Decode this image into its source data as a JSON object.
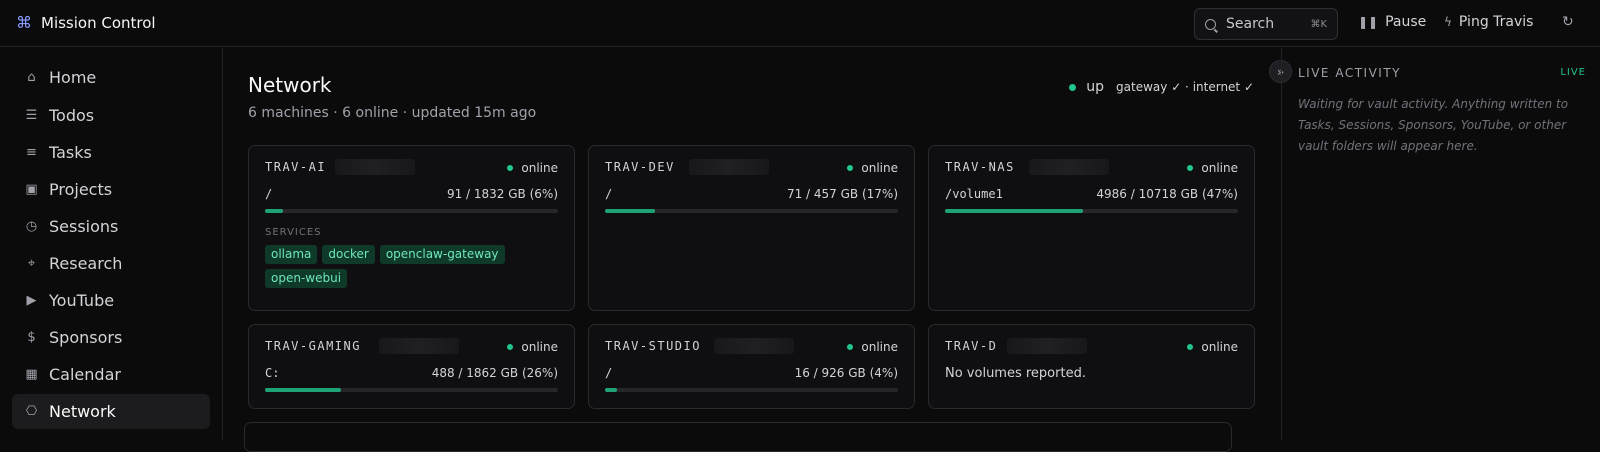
{
  "app": {
    "title": "Mission Control",
    "icon": "command-icon"
  },
  "topbar": {
    "search_label": "Search",
    "search_shortcut": "⌘K",
    "pause_label": "Pause",
    "ping_label": "Ping Travis"
  },
  "sidebar": {
    "items": [
      {
        "label": "Home",
        "icon": "home-icon"
      },
      {
        "label": "Todos",
        "icon": "list-checks-icon"
      },
      {
        "label": "Tasks",
        "icon": "list-todo-icon"
      },
      {
        "label": "Projects",
        "icon": "folders-icon"
      },
      {
        "label": "Sessions",
        "icon": "history-icon"
      },
      {
        "label": "Research",
        "icon": "telescope-icon"
      },
      {
        "label": "YouTube",
        "icon": "youtube-icon"
      },
      {
        "label": "Sponsors",
        "icon": "dollar-icon"
      },
      {
        "label": "Calendar",
        "icon": "calendar-icon"
      },
      {
        "label": "Network",
        "icon": "network-icon",
        "active": true
      }
    ]
  },
  "main": {
    "title": "Network",
    "subtitle": "6 machines · 6 online · updated 15m ago",
    "status": {
      "state": "up",
      "checks": "gateway ✓ · internet ✓",
      "color": "#22c58b"
    },
    "services_label": "SERVICES",
    "cards": [
      {
        "name": "TRAV-AI",
        "status": "online",
        "volume": "/",
        "usage": "91 / 1832 GB (6%)",
        "percent": 6,
        "services": [
          "ollama",
          "docker",
          "openclaw-gateway",
          "open-webui"
        ]
      },
      {
        "name": "TRAV-DEV",
        "status": "online",
        "volume": "/",
        "usage": "71 / 457 GB (17%)",
        "percent": 17
      },
      {
        "name": "TRAV-NAS",
        "status": "online",
        "volume": "/volume1",
        "usage": "4986 / 10718 GB (47%)",
        "percent": 47
      },
      {
        "name": "TRAV-GAMING",
        "status": "online",
        "volume": "C:",
        "usage": "488 / 1862 GB (26%)",
        "percent": 26
      },
      {
        "name": "TRAV-STUDIO",
        "status": "online",
        "volume": "/",
        "usage": "16 / 926 GB (4%)",
        "percent": 4
      },
      {
        "name": "TRAV-D",
        "status": "online",
        "no_volumes": "No volumes reported."
      }
    ]
  },
  "activity": {
    "title": "LIVE ACTIVITY",
    "badge": "LIVE",
    "message": "Waiting for vault activity. Anything written to Tasks, Sessions, Sponsors, YouTube, or other vault folders will appear here."
  },
  "colors": {
    "accent": "#22c58b",
    "bar_fill": "#1fa376",
    "background": "#0b0b0c"
  }
}
